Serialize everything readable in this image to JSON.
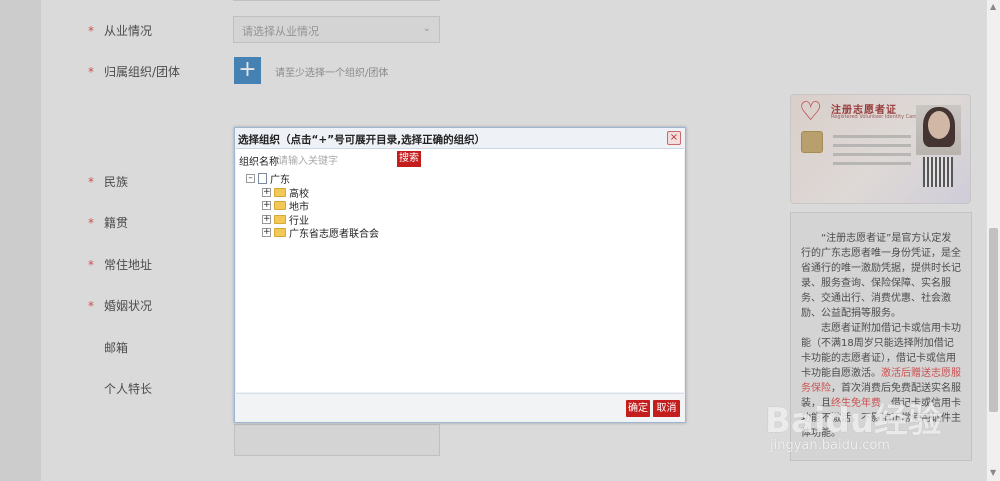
{
  "form": {
    "fields": [
      {
        "required": "*",
        "label": "从业情况"
      },
      {
        "required": "*",
        "label": "归属组织/团体"
      },
      {
        "required": "*",
        "label": "民族"
      },
      {
        "required": "*",
        "label": "籍贯"
      },
      {
        "required": "*",
        "label": "常住地址"
      },
      {
        "required": "*",
        "label": "婚姻状况"
      },
      {
        "required": "",
        "label": "邮箱"
      },
      {
        "required": "",
        "label": "个人特长"
      }
    ],
    "occupation_placeholder": "请选择从业情况",
    "add_org_button": "+",
    "add_org_hint": "请至少选择一个组织/团体"
  },
  "dialog": {
    "title": "选择组织（点击“+”号可展开目录,选择正确的组织）",
    "close": "×",
    "search_label": "组织名称",
    "search_placeholder": "请输入关键字",
    "search_button": "搜索",
    "tree": {
      "root": {
        "toggle": "⊟",
        "label": "广东"
      },
      "children": [
        {
          "toggle": "+",
          "label": "高校"
        },
        {
          "toggle": "+",
          "label": "地市"
        },
        {
          "toggle": "+",
          "label": "行业"
        },
        {
          "toggle": "+",
          "label": "广东省志愿者联合会"
        }
      ]
    },
    "ok_button": "确定",
    "cancel_button": "取消"
  },
  "card": {
    "title": "注册志愿者证",
    "subtitle": "Registered Volunteer Identity Card"
  },
  "info": {
    "paragraph1": "“注册志愿者证”是官方认定发行的广东志愿者唯一身份凭证，是全省通行的唯一激励凭据，提供时长记录、服务查询、保险保障、实名服务、交通出行、消费优惠、社会激励、公益配捐等服务。",
    "paragraph2_a": "志愿者证附加借记卡或信用卡功能（不满18周岁只能选择附加借记卡功能的志愿者证），借记卡或信用卡功能自愿激活。",
    "paragraph2_highlight": "激活后赠送志愿服务保险",
    "paragraph2_b": "，首次消费后免费配送实名服装，且",
    "paragraph2_highlight2": "终生免年费",
    "paragraph2_c": "。借记卡或信用卡功能不激活，不影响正常使用证件主体功能。"
  },
  "watermark": {
    "brand": "Baidu经验",
    "url": "jingyan.baidu.com"
  },
  "scrollbar": {
    "up": "▲",
    "down": "▼"
  },
  "colors": {
    "accent_red": "#c41d1d",
    "add_blue": "#4f90c9",
    "required_red": "#e05a5a"
  }
}
